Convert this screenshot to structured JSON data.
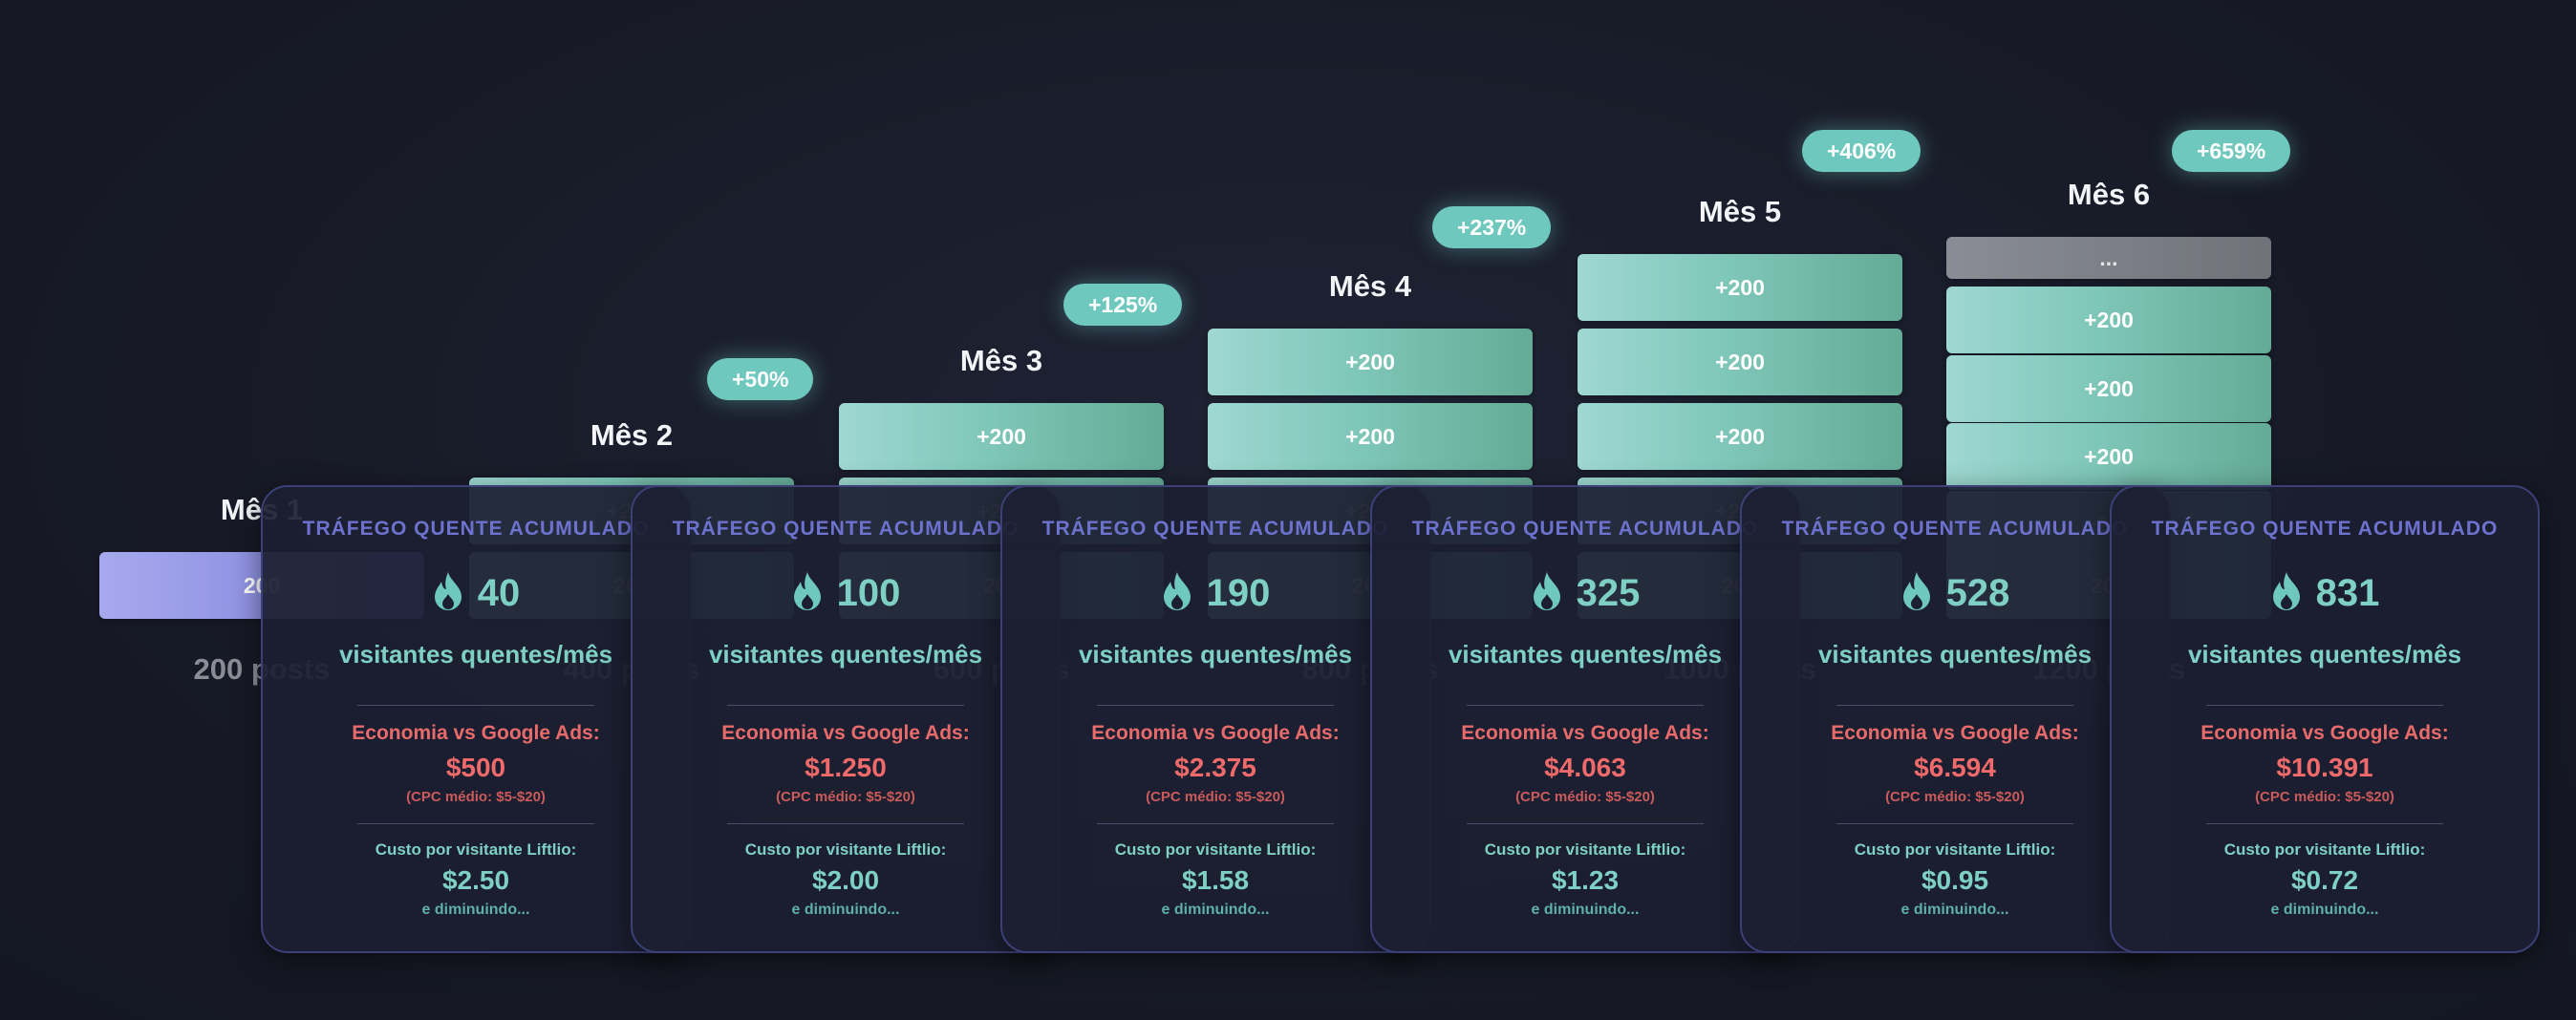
{
  "months": [
    {
      "title": "Mês 1",
      "badge": "",
      "blocks": [
        "200"
      ],
      "posts": "200 posts"
    },
    {
      "title": "Mês 2",
      "badge": "+50%",
      "blocks": [
        "+200",
        "200"
      ],
      "posts": "400 posts"
    },
    {
      "title": "Mês 3",
      "badge": "+125%",
      "blocks": [
        "+200",
        "+200",
        "200"
      ],
      "posts": "600 posts"
    },
    {
      "title": "Mês 4",
      "badge": "+237%",
      "blocks": [
        "+200",
        "+200",
        "+200",
        "200"
      ],
      "posts": "800 posts"
    },
    {
      "title": "Mês 5",
      "badge": "+406%",
      "blocks": [
        "+200",
        "+200",
        "+200",
        "+200",
        "200"
      ],
      "posts": "1000 posts"
    },
    {
      "title": "Mês 6",
      "badge": "+659%",
      "blocks": [
        "...",
        "+200",
        "+200",
        "+200",
        "+200",
        "200"
      ],
      "posts": "1200 posts"
    }
  ],
  "cards": [
    {
      "title": "TRÁFEGO QUENTE ACUMULADO",
      "visitors": "40",
      "unit": "visitantes quentes/mês",
      "economy_label": "Economia vs Google Ads:",
      "economy_value": "$500",
      "cpc_note": "(CPC médio: $5-$20)",
      "cost_label": "Custo por visitante Liftlio:",
      "cost_value": "$2.50",
      "trend": "e diminuindo..."
    },
    {
      "title": "TRÁFEGO QUENTE ACUMULADO",
      "visitors": "100",
      "unit": "visitantes quentes/mês",
      "economy_label": "Economia vs Google Ads:",
      "economy_value": "$1.250",
      "cpc_note": "(CPC médio: $5-$20)",
      "cost_label": "Custo por visitante Liftlio:",
      "cost_value": "$2.00",
      "trend": "e diminuindo..."
    },
    {
      "title": "TRÁFEGO QUENTE ACUMULADO",
      "visitors": "190",
      "unit": "visitantes quentes/mês",
      "economy_label": "Economia vs Google Ads:",
      "economy_value": "$2.375",
      "cpc_note": "(CPC médio: $5-$20)",
      "cost_label": "Custo por visitante Liftlio:",
      "cost_value": "$1.58",
      "trend": "e diminuindo..."
    },
    {
      "title": "TRÁFEGO QUENTE ACUMULADO",
      "visitors": "325",
      "unit": "visitantes quentes/mês",
      "economy_label": "Economia vs Google Ads:",
      "economy_value": "$4.063",
      "cpc_note": "(CPC médio: $5-$20)",
      "cost_label": "Custo por visitante Liftlio:",
      "cost_value": "$1.23",
      "trend": "e diminuindo..."
    },
    {
      "title": "TRÁFEGO QUENTE ACUMULADO",
      "visitors": "528",
      "unit": "visitantes quentes/mês",
      "economy_label": "Economia vs Google Ads:",
      "economy_value": "$6.594",
      "cpc_note": "(CPC médio: $5-$20)",
      "cost_label": "Custo por visitante Liftlio:",
      "cost_value": "$0.95",
      "trend": "e diminuindo..."
    },
    {
      "title": "TRÁFEGO QUENTE ACUMULADO",
      "visitors": "831",
      "unit": "visitantes quentes/mês",
      "economy_label": "Economia vs Google Ads:",
      "economy_value": "$10.391",
      "cpc_note": "(CPC médio: $5-$20)",
      "cost_label": "Custo por visitante Liftlio:",
      "cost_value": "$0.72",
      "trend": "e diminuindo..."
    }
  ],
  "icons": {
    "card_icon": "fire-icon"
  },
  "colors": {
    "accent": "#6fc8bd",
    "card_title": "#6d72cf",
    "economy": "#ef6a6a",
    "first_block": "#8a8de0"
  }
}
